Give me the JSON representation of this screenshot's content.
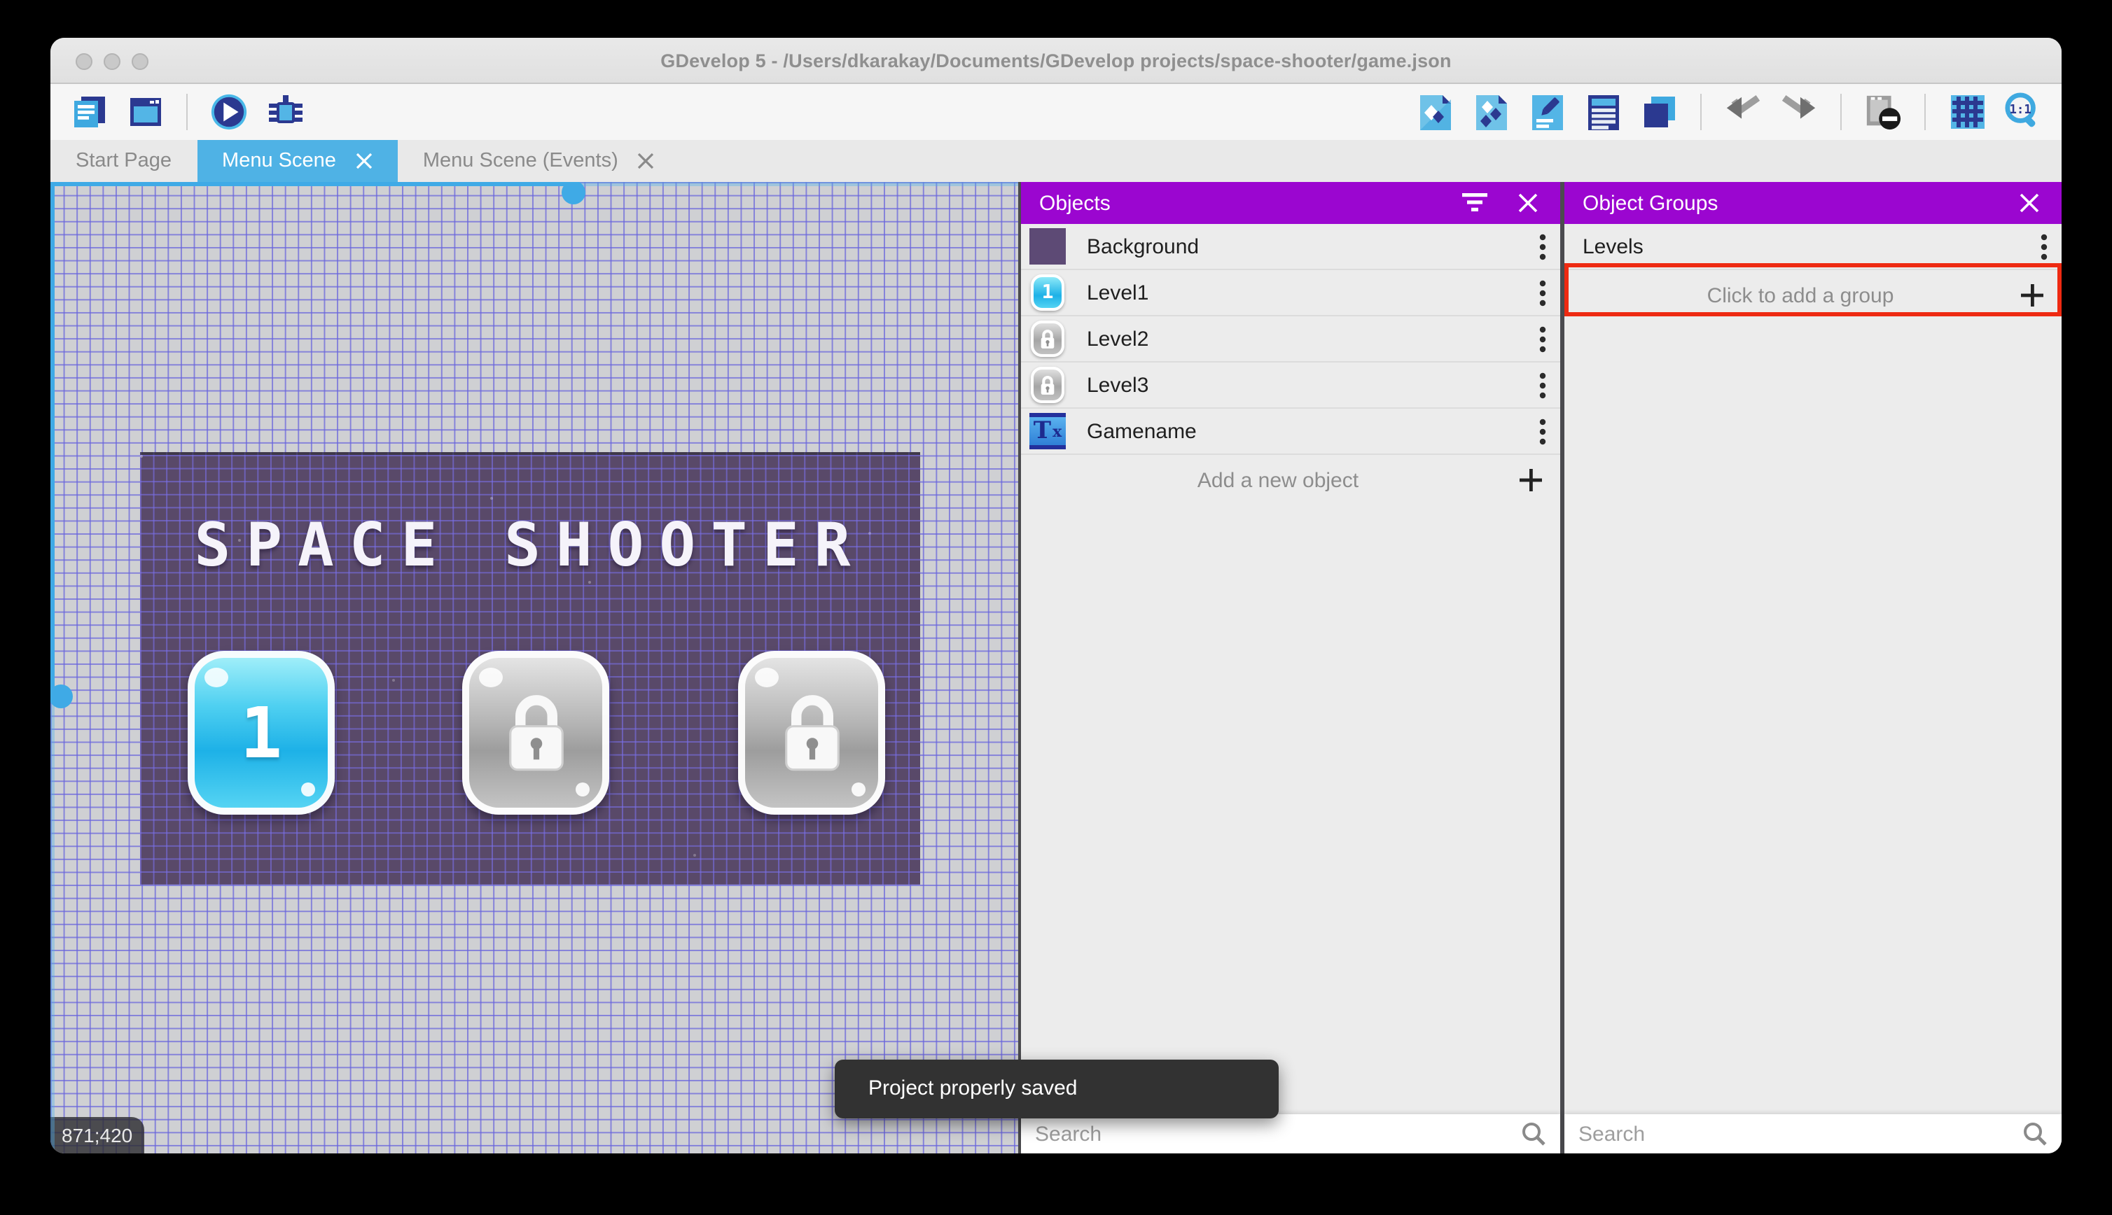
{
  "window": {
    "title": "GDevelop 5 - /Users/dkarakay/Documents/GDevelop projects/space-shooter/game.json"
  },
  "tabs": [
    {
      "label": "Start Page",
      "active": false,
      "closable": false
    },
    {
      "label": "Menu Scene",
      "active": true,
      "closable": true
    },
    {
      "label": "Menu Scene (Events)",
      "active": false,
      "closable": true
    }
  ],
  "toolbar": {
    "left_icons": [
      "project-manager-icon",
      "scene-window-icon",
      "preview-play-icon",
      "debug-icon"
    ],
    "right_icons": [
      "objects-editor-icon",
      "object-groups-icon",
      "properties-icon",
      "instances-list-icon",
      "layers-icon",
      "undo-icon",
      "redo-icon",
      "instances-mask-icon",
      "grid-icon",
      "zoom-1-1-icon"
    ]
  },
  "canvas": {
    "coordinates": "871;420",
    "toast": "Project properly saved",
    "scene": {
      "title": "SPACE SHOOTER",
      "buttons": [
        {
          "label": "1",
          "state": "unlocked"
        },
        {
          "label": "",
          "state": "locked"
        },
        {
          "label": "",
          "state": "locked"
        }
      ]
    }
  },
  "objectsPanel": {
    "title": "Objects",
    "items": [
      {
        "label": "Background",
        "icon": "background-thumbnail"
      },
      {
        "label": "Level1",
        "icon": "level1-button-thumbnail"
      },
      {
        "label": "Level2",
        "icon": "locked-button-thumbnail"
      },
      {
        "label": "Level3",
        "icon": "locked-button-thumbnail"
      },
      {
        "label": "Gamename",
        "icon": "text-object-thumbnail"
      }
    ],
    "add_label": "Add a new object",
    "search_placeholder": "Search"
  },
  "groupsPanel": {
    "title": "Object Groups",
    "items": [
      {
        "label": "Levels",
        "highlighted": true
      }
    ],
    "add_label": "Click to add a group",
    "search_placeholder": "Search"
  },
  "colors": {
    "accent_blue": "#4FB2E5",
    "panel_purple": "#9B06D0",
    "annotation_red": "#EE2A12",
    "scene_purple": "#594969",
    "toast_dark": "#323232"
  }
}
